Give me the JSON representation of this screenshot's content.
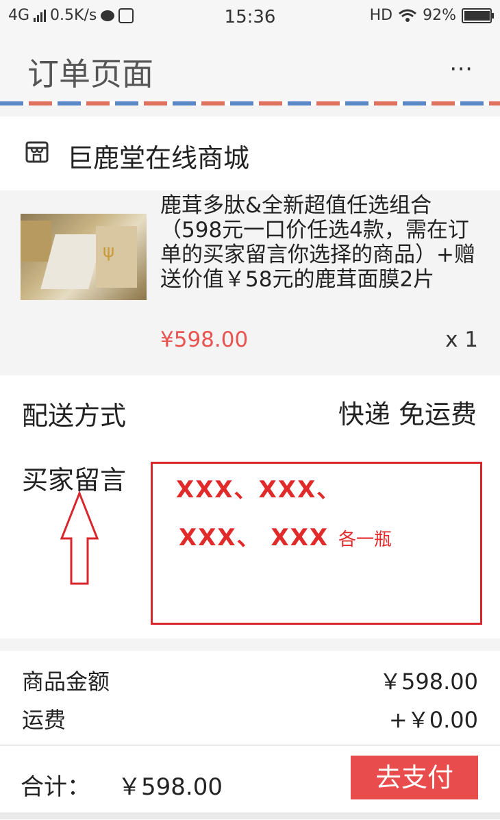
{
  "status_bar": {
    "network": "4G",
    "speed": "0.5K/s",
    "time": "15:36",
    "hd": "HD",
    "battery": "92%",
    "battery_level": 0.92
  },
  "header": {
    "title": "订单页面",
    "more": "⋯"
  },
  "shop": {
    "name": "巨鹿堂在线商城",
    "icon": "store-icon"
  },
  "product": {
    "title": "鹿茸多肽&全新超值任选组合（598元一口价任选4款，需在订单的买家留言你选择的商品）+赠送价值￥58元的鹿茸面膜2片",
    "price": "¥598.00",
    "quantity": "x 1"
  },
  "shipping": {
    "label": "配送方式",
    "value": "快递 免运费"
  },
  "buyer_note": {
    "label": "买家留言",
    "line1": "XXX、XXX、",
    "line2": "XXX、 XXX ",
    "line2_suffix": "各一瓶",
    "annotation_color": "#d8262c"
  },
  "totals": {
    "goods_label": "商品金额",
    "goods_value": "￥598.00",
    "freight_label": "运费",
    "freight_value": "+￥0.00"
  },
  "footer": {
    "total_label": "合计：",
    "total_value": "￥598.00",
    "pay_button": "去支付"
  },
  "colors": {
    "accent_red": "#e94c4c",
    "price_red": "#e85451"
  }
}
